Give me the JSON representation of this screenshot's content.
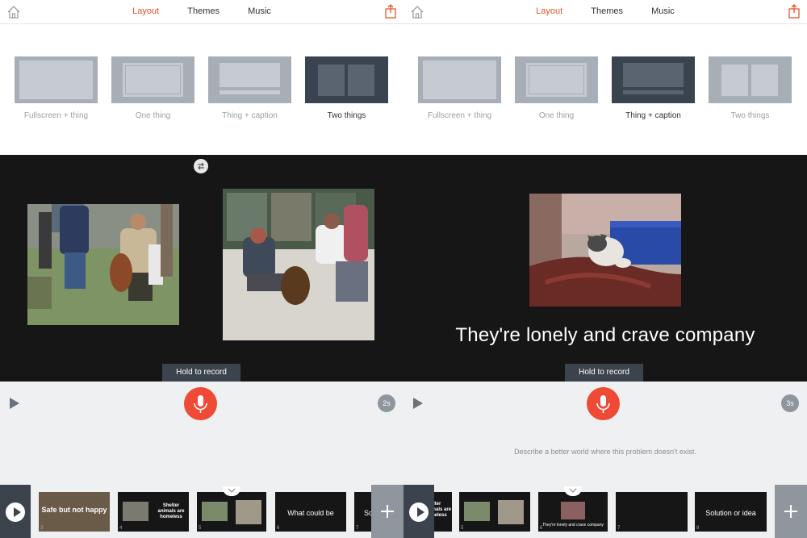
{
  "nav": {
    "tabs": [
      "Layout",
      "Themes",
      "Music"
    ],
    "active_tab": "Layout"
  },
  "layouts": [
    "Fullscreen + thing",
    "One thing",
    "Thing + caption",
    "Two things"
  ],
  "left": {
    "selected_layout": "Two things",
    "hold_to_record": "Hold to record",
    "duration": "2s",
    "slides": [
      {
        "num": "3",
        "text": "Safe but not happy"
      },
      {
        "num": "4",
        "text": "Shelter animals are homeless"
      },
      {
        "num": "5",
        "text": ""
      },
      {
        "num": "6",
        "text": "What could be"
      },
      {
        "num": "7",
        "text": "So"
      }
    ]
  },
  "right": {
    "selected_layout": "Thing + caption",
    "caption": "They're lonely and crave company",
    "hold_to_record": "Hold to record",
    "duration": "3s",
    "hint": "Describe a better world where this problem doesn't exist.",
    "slides": [
      {
        "num": "",
        "text": "Shelter animals are homeless"
      },
      {
        "num": "5",
        "text": ""
      },
      {
        "num": "6",
        "text": "They're lonely and crave company"
      },
      {
        "num": "7",
        "text": ""
      },
      {
        "num": "8",
        "text": "Solution or idea"
      }
    ]
  },
  "colors": {
    "accent": "#e8542e",
    "record": "#ee4a35",
    "dark_panel": "#3b434c",
    "stage": "#161616"
  }
}
